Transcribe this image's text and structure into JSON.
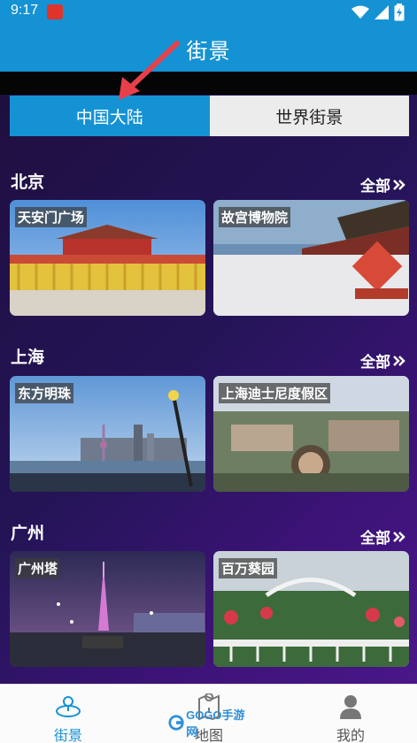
{
  "status": {
    "time": "9:17"
  },
  "header": {
    "title": "街景"
  },
  "tabs": [
    {
      "label": "中国大陆",
      "active": true
    },
    {
      "label": "世界街景",
      "active": false
    }
  ],
  "sections": [
    {
      "title": "北京",
      "all_label": "全部",
      "cards": [
        {
          "label": "天安门广场"
        },
        {
          "label": "故宫博物院"
        }
      ]
    },
    {
      "title": "上海",
      "all_label": "全部",
      "cards": [
        {
          "label": "东方明珠"
        },
        {
          "label": "上海迪士尼度假区"
        }
      ]
    },
    {
      "title": "广州",
      "all_label": "全部",
      "cards": [
        {
          "label": "广州塔"
        },
        {
          "label": "百万葵园"
        }
      ]
    }
  ],
  "bottom_nav": [
    {
      "label": "街景",
      "active": true
    },
    {
      "label": "地图",
      "active": false
    },
    {
      "label": "我的",
      "active": false
    }
  ],
  "watermark": {
    "text": "GOGO手游网"
  },
  "colors": {
    "accent": "#1592d3",
    "annotation_arrow": "#e8404a"
  }
}
